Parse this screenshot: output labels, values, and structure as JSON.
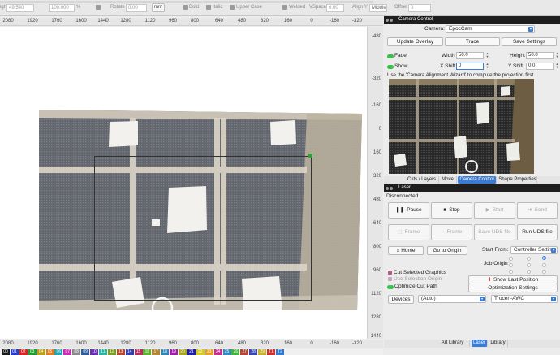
{
  "toolbar": {
    "height_value": "49.540",
    "height_label": "ight",
    "size_value": "100.000",
    "percent": "%",
    "rotate_label": "Rotate",
    "rotate_value": "0.00",
    "unit": "mm",
    "bold": "Bold",
    "italic": "Italic",
    "upper_case": "Upper Case",
    "welded": "Welded",
    "vspace_label": "VSpace",
    "vspace_value": "0.00",
    "align_label": "Align Y",
    "align_value": "Middle",
    "offset_label": "Offset",
    "offset_value": "0"
  },
  "ruler": {
    "top_ticks": [
      "2080",
      "1920",
      "1760",
      "1600",
      "1440",
      "1280",
      "1120",
      "960",
      "800",
      "640",
      "480",
      "320",
      "160",
      "0",
      "-160",
      "-320"
    ],
    "right_ticks": [
      "-480",
      "-320",
      "-160",
      "0",
      "160",
      "320",
      "480",
      "640",
      "800",
      "960",
      "1120",
      "1280",
      "1440"
    ],
    "bottom_ticks": [
      "2080",
      "1920",
      "1760",
      "1600",
      "1440",
      "1280",
      "1120",
      "960",
      "800",
      "640",
      "480",
      "320",
      "160",
      "0",
      "-160",
      "-320"
    ]
  },
  "palette": {
    "swatches": [
      {
        "label": "00",
        "color": "#1a1a1a"
      },
      {
        "label": "01",
        "color": "#2a3ec9"
      },
      {
        "label": "02",
        "color": "#d42626"
      },
      {
        "label": "03",
        "color": "#1f9e2d"
      },
      {
        "label": "04",
        "color": "#b7a11a"
      },
      {
        "label": "05",
        "color": "#e07a1f"
      },
      {
        "label": "06",
        "color": "#1fa6b7"
      },
      {
        "label": "07",
        "color": "#c72fb3"
      },
      {
        "label": "08",
        "color": "#8a8a8a"
      },
      {
        "label": "09",
        "color": "#2f5d9a"
      },
      {
        "label": "10",
        "color": "#6a2fb3"
      },
      {
        "label": "11",
        "color": "#2fb3a0"
      },
      {
        "label": "12",
        "color": "#7a9e1f"
      },
      {
        "label": "13",
        "color": "#b34a2f"
      },
      {
        "label": "14",
        "color": "#2f3eb3"
      },
      {
        "label": "15",
        "color": "#b32f5a"
      },
      {
        "label": "16",
        "color": "#5ab32f"
      },
      {
        "label": "17",
        "color": "#b3862f"
      },
      {
        "label": "18",
        "color": "#2f86b3"
      },
      {
        "label": "19",
        "color": "#9e1fa6"
      },
      {
        "label": "20",
        "color": "#a6a61f"
      },
      {
        "label": "21",
        "color": "#1f1fa6"
      },
      {
        "label": "22",
        "color": "#d4c826"
      },
      {
        "label": "23",
        "color": "#e3a326"
      },
      {
        "label": "24",
        "color": "#c42f8a"
      },
      {
        "label": "25",
        "color": "#2f8ac4"
      },
      {
        "label": "26",
        "color": "#45b33a"
      },
      {
        "label": "27",
        "color": "#b3453a"
      },
      {
        "label": "28",
        "color": "#3a45b3"
      },
      {
        "label": "29",
        "color": "#c4b32f"
      },
      {
        "label": "T1",
        "color": "#cf2f2f"
      },
      {
        "label": "T2",
        "color": "#2f7acf"
      }
    ]
  },
  "camera_panel": {
    "title": "Camera Control",
    "camera_label": "Camera:",
    "camera_value": "EpocCam",
    "update_overlay": "Update Overlay",
    "trace": "Trace",
    "save_settings": "Save Settings",
    "fade_label": "Fade",
    "show_label": "Show",
    "width_label": "Width",
    "width_value": "50.0",
    "height_label": "Height",
    "height_value": "50.0",
    "xshift_label": "X Shift",
    "xshift_value": "0",
    "yshift_label": "Y Shift",
    "yshift_value": "0.0",
    "wizard_note": "Use the 'Camera Alignment Wizard' to compute the projection first",
    "tabs": [
      "Cuts / Layers",
      "Move",
      "Camera Control",
      "Shape Properties"
    ],
    "active_tab": 2
  },
  "laser_panel": {
    "title": "Laser",
    "status": "Disconnected",
    "pause": "Pause",
    "stop": "Stop",
    "start": "Start",
    "send": "Send",
    "frame1": "Frame",
    "frame2": "Frame",
    "save_uds": "Save UDS file",
    "run_uds": "Run UDS file",
    "home": "Home",
    "go_to_origin": "Go to Origin",
    "start_from_label": "Start From:",
    "start_from_value": "Controller Setting",
    "job_origin_label": "Job Origin",
    "cut_selected": "Cut Selected Graphics",
    "use_selection_origin": "Use Selection Origin",
    "optimize_cut_path": "Optimize Cut Path",
    "show_last_position": "Show Last Position",
    "optimization_settings": "Optimization Settings",
    "devices": "Devices",
    "devices_value": "(Auto)",
    "machine_value": "Trocen-AWC"
  },
  "bottom_tabs": [
    "Art Library",
    "Laser",
    "Library"
  ],
  "bottom_active": 1,
  "colors": {
    "accent": "#3a7bd5",
    "toggle_on": "#35c24a",
    "origin_dot": "#2da12d",
    "panel_header": "#1e1e1e"
  }
}
